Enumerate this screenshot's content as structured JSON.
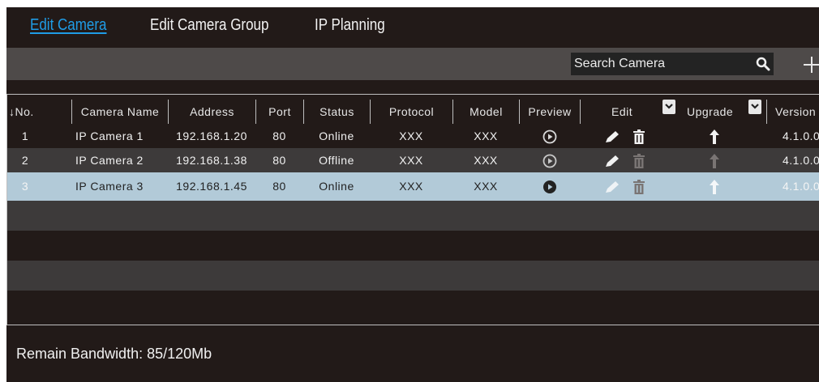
{
  "tabs": [
    {
      "label": "Edit Camera",
      "active": true
    },
    {
      "label": "Edit Camera Group",
      "active": false
    },
    {
      "label": "IP Planning",
      "active": false
    }
  ],
  "search": {
    "placeholder": "Search Camera"
  },
  "columns": [
    "↓No.",
    "Camera Name",
    "Address",
    "Port",
    "Status",
    "Protocol",
    "Model",
    "Preview",
    "Edit",
    "Upgrade",
    "Version"
  ],
  "rows": [
    {
      "no": "1",
      "name": "IP Camera 1",
      "address": "192.168.1.20",
      "port": "80",
      "status": "Online",
      "protocol": "XXX",
      "model": "XXX",
      "version": "4.1.0.0"
    },
    {
      "no": "2",
      "name": "IP Camera 2",
      "address": "192.168.1.38",
      "port": "80",
      "status": "Offline",
      "protocol": "XXX",
      "model": "XXX",
      "version": "4.1.0.0"
    },
    {
      "no": "3",
      "name": "IP Camera 3",
      "address": "192.168.1.45",
      "port": "80",
      "status": "Online",
      "protocol": "XXX",
      "model": "XXX",
      "version": "4.1.0.0",
      "selected": true
    }
  ],
  "footer": {
    "bandwidth": "Remain Bandwidth: 85/120Mb"
  },
  "colors": {
    "accent": "#1f9ce6",
    "background": "#221a18",
    "selected_row": "#b2cad8",
    "toolbar": "#4e4a49"
  }
}
